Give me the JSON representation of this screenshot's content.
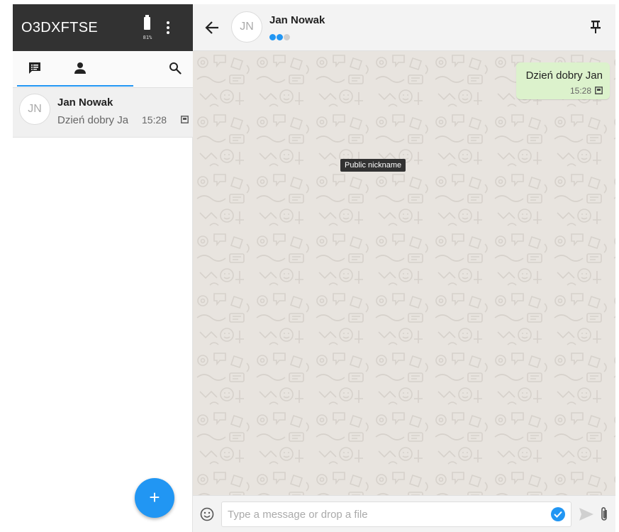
{
  "left_header": {
    "identity": "O3DXFTSE",
    "battery_level": "81%"
  },
  "icons": {
    "chats_tab": "chat-list-icon",
    "contacts_tab": "person-icon",
    "search": "search-icon",
    "menu": "more-vert-icon",
    "back": "arrow-back-icon",
    "pin": "pin-icon",
    "emoji": "emoji-icon",
    "send": "send-icon",
    "attach": "paperclip-icon",
    "add": "plus-icon",
    "message_status": "delivered-icon"
  },
  "conversations": [
    {
      "initials": "JN",
      "name": "Jan Nowak",
      "preview": "Dzień dobry Jan",
      "time": "15:28"
    }
  ],
  "chat": {
    "contact_initials": "JN",
    "contact_name": "Jan Nowak",
    "trust_level_dots": [
      true,
      true,
      false
    ],
    "tooltip": "Public nickname",
    "messages": [
      {
        "text": "Dzień dobry Jan",
        "time": "15:28",
        "outgoing": true
      }
    ]
  },
  "composer": {
    "placeholder": "Type a message or drop a file"
  },
  "fab": {
    "label": "+"
  },
  "colors": {
    "accent": "#2196f3",
    "header_dark": "#323232",
    "outgoing_bubble": "#dcf2cc",
    "trust_on": "#2196f3",
    "trust_off": "#cfcfcf"
  }
}
